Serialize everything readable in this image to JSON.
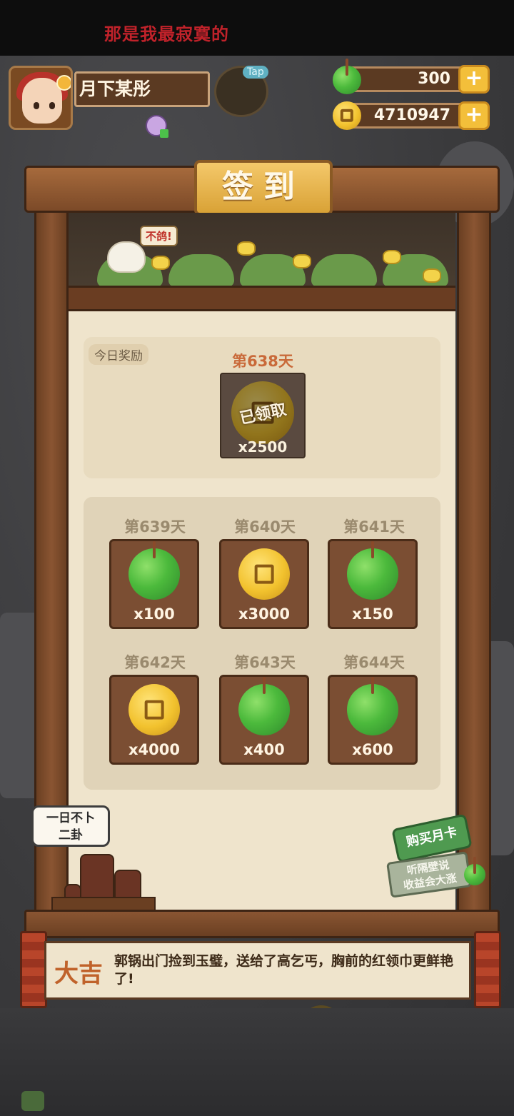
{
  "marquee_text": "那是我最寂寞的",
  "profile": {
    "nickname": "月下某彤"
  },
  "tap_label": "Tap",
  "currency": {
    "jade_amount": "300",
    "coin_amount": "4710947",
    "plus_symbol": "+"
  },
  "board": {
    "title": "签到",
    "bird_speech": "不鸽!"
  },
  "today": {
    "tag": "今日奖励",
    "day": "第638天",
    "stamp": "已领取",
    "quantity": "x2500",
    "reward_type": "coin-icon"
  },
  "upcoming": [
    {
      "day": "第639天",
      "quantity": "x100",
      "reward_type": "jade-icon"
    },
    {
      "day": "第640天",
      "quantity": "x3000",
      "reward_type": "coin-icon"
    },
    {
      "day": "第641天",
      "quantity": "x150",
      "reward_type": "jade-icon"
    },
    {
      "day": "第642天",
      "quantity": "x4000",
      "reward_type": "coin-icon"
    },
    {
      "day": "第643天",
      "quantity": "x400",
      "reward_type": "jade-icon"
    },
    {
      "day": "第644天",
      "quantity": "x600",
      "reward_type": "jade-icon"
    }
  ],
  "speech_bubble": {
    "line1": "一日不卜",
    "line2": "二卦"
  },
  "monthly_card": {
    "button_label": "购买月卡",
    "sign_line1": "听隔壁说",
    "sign_line2": "收益会大涨"
  },
  "fortune": {
    "rank": "大吉",
    "text": "郭锅出门捡到玉璧，送给了高乞丐，胸前的红领巾更鲜艳了!"
  },
  "colors": {
    "wood": "#7c4a28",
    "panel": "#efe4cc",
    "gold": "#f3bf3a",
    "jade": "#4cba3c",
    "accent_red": "#c0622a"
  }
}
